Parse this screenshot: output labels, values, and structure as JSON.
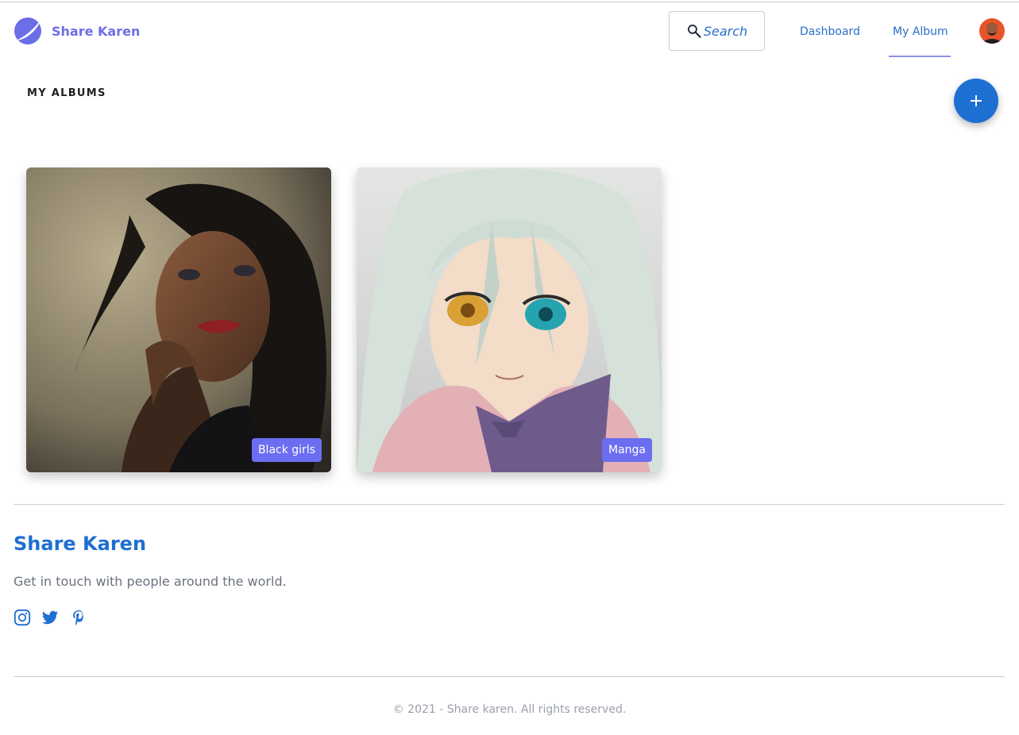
{
  "header": {
    "brand_name": "Share Karen",
    "logo_icon": "brand-logo-icon",
    "search_label": "Search",
    "search_icon": "search-icon",
    "nav": [
      {
        "label": "Dashboard",
        "active": false
      },
      {
        "label": "My Album",
        "active": true
      }
    ]
  },
  "main": {
    "section_title": "MY ALBUMS",
    "fab_icon": "plus-icon",
    "albums": [
      {
        "label": "Black girls"
      },
      {
        "label": "Manga"
      }
    ]
  },
  "footer": {
    "title": "Share Karen",
    "tagline": "Get in touch with people around the world.",
    "social": [
      "instagram-icon",
      "twitter-icon",
      "pinterest-icon"
    ],
    "copyright": "© 2021 - Share karen. All rights reserved."
  },
  "colors": {
    "brand": "#6c6ee8",
    "link": "#2a6fc9",
    "fab": "#1e6fd2",
    "badge": "#6b6ef0"
  }
}
